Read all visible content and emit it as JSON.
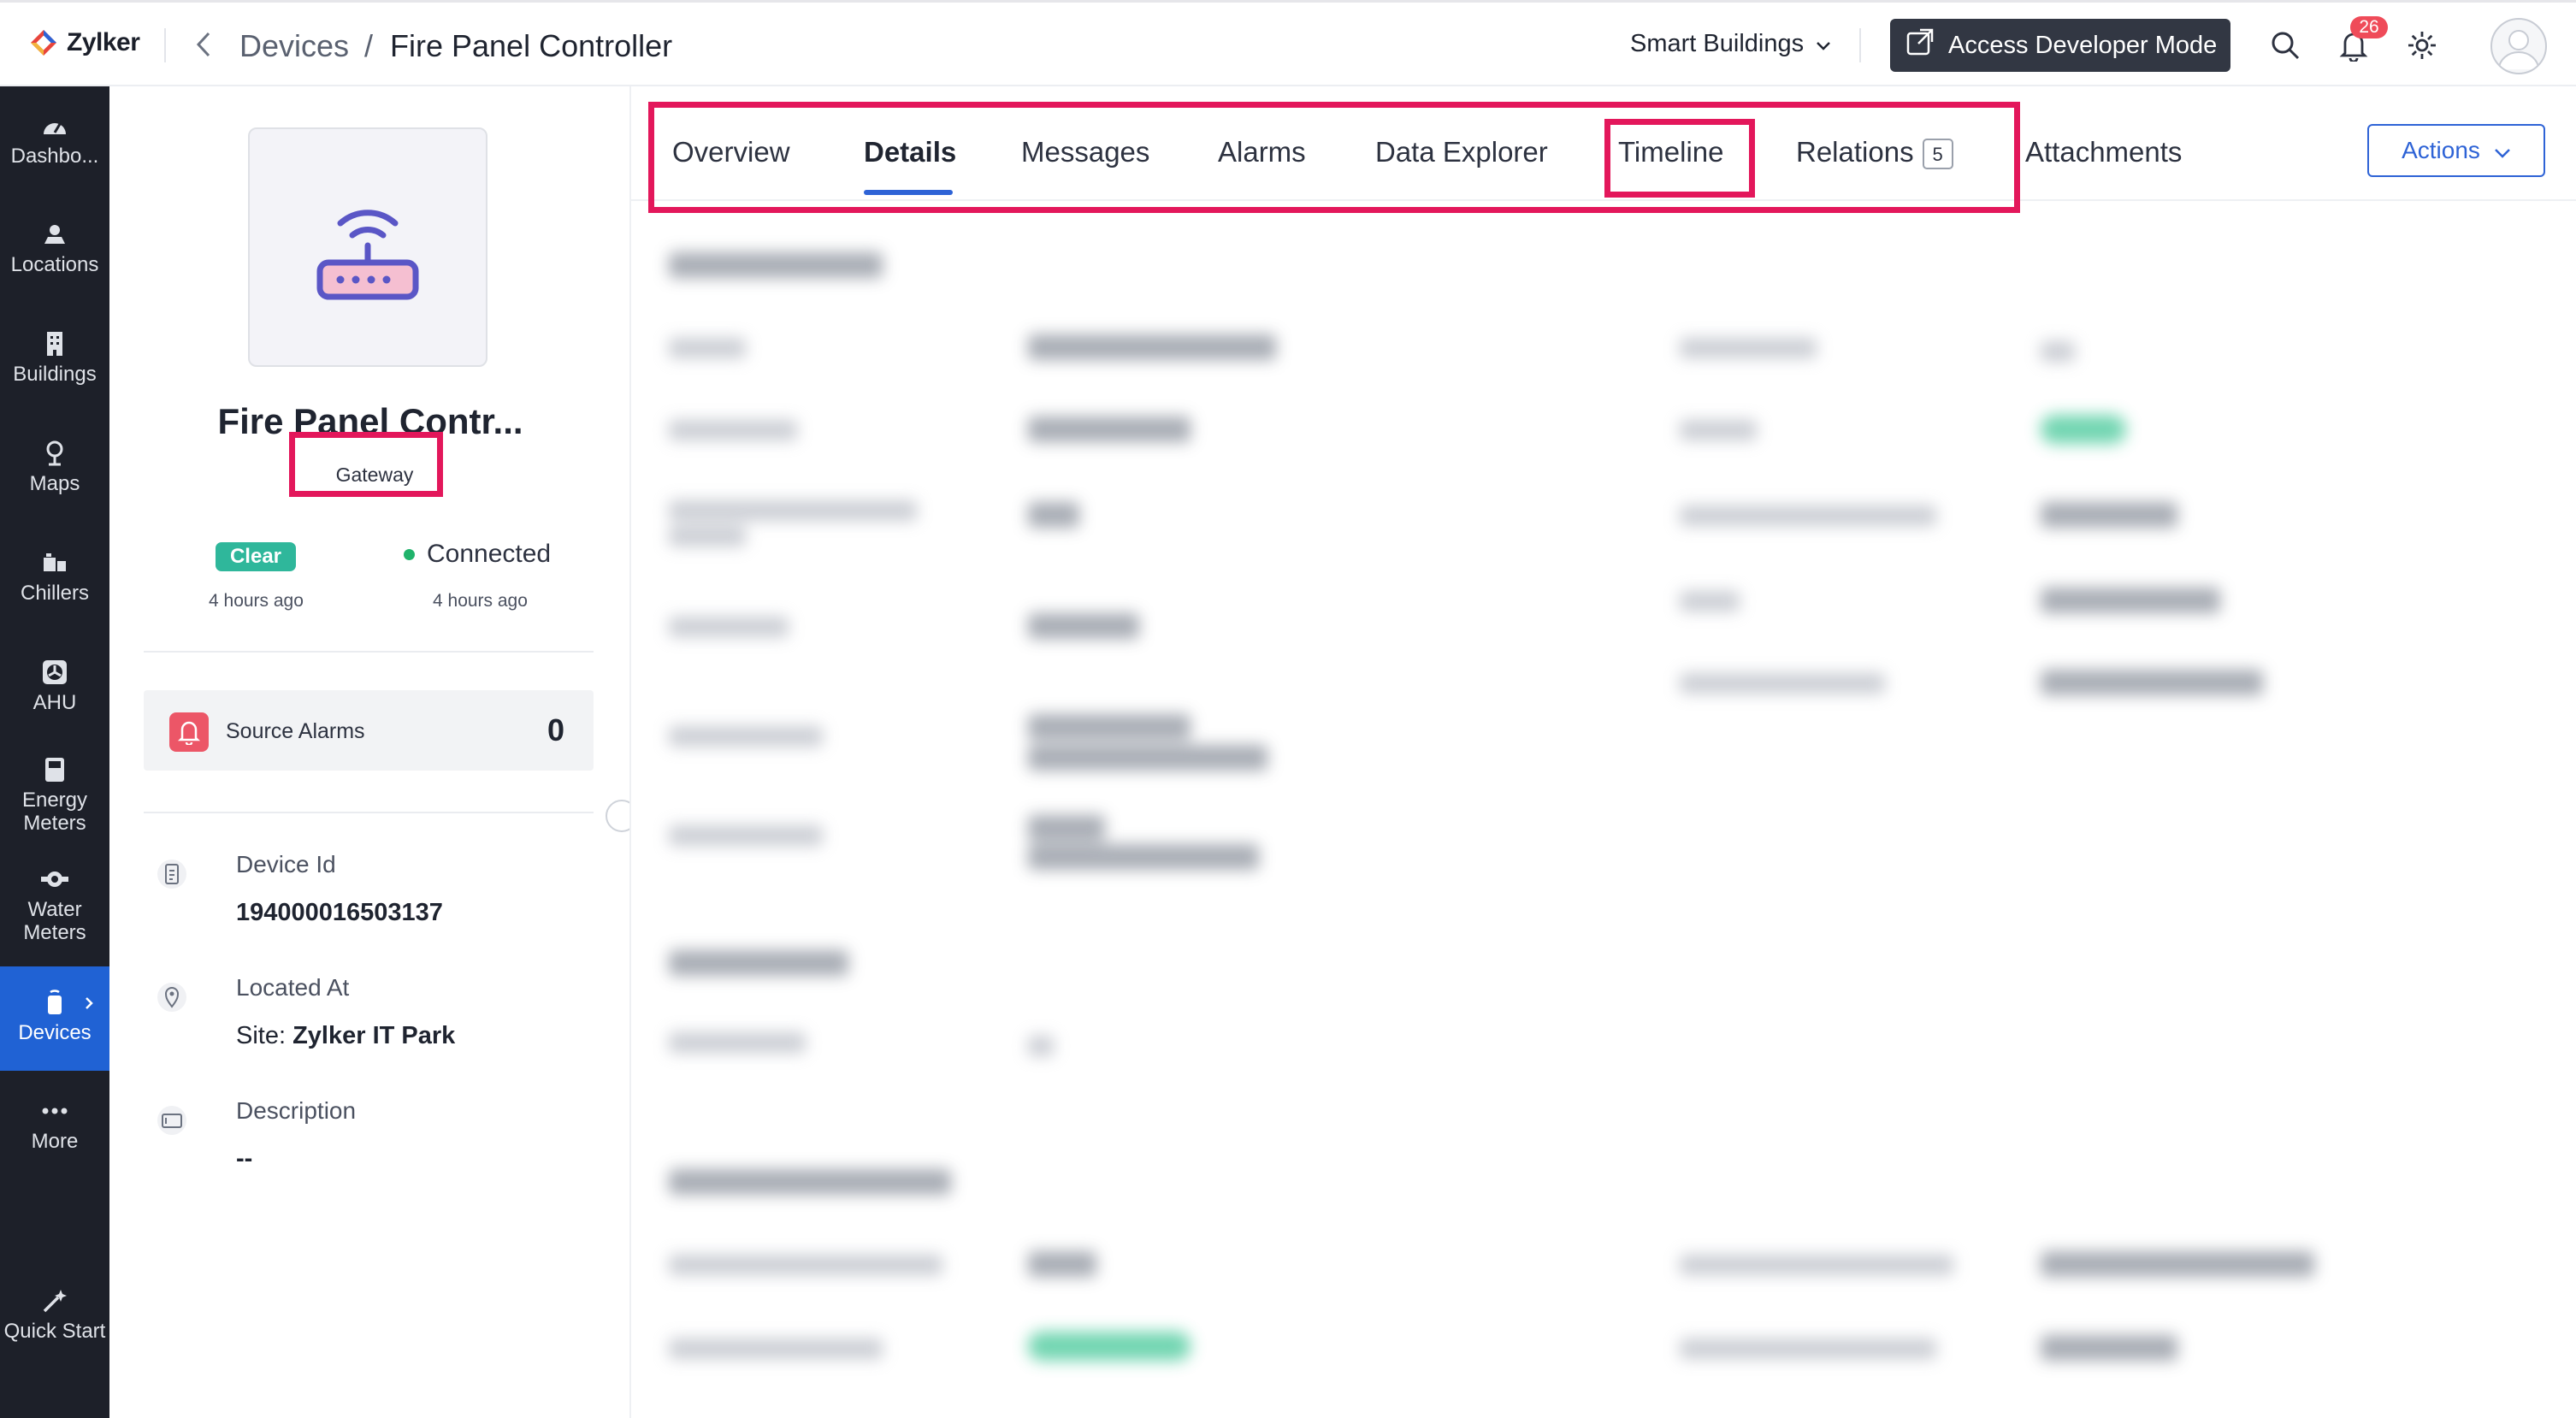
{
  "header": {
    "brand": "Zylker",
    "breadcrumb": {
      "parent": "Devices",
      "separator": "/",
      "current": "Fire Panel Controller"
    },
    "workspace": "Smart Buildings",
    "developer_mode_label": "Access Developer Mode",
    "notification_count": "26",
    "icons": [
      "back-chevron-icon",
      "chevron-down-icon",
      "external-link-icon",
      "search-icon",
      "bell-icon",
      "gear-icon",
      "avatar"
    ]
  },
  "sidebar": {
    "items": [
      {
        "label": "Dashbo...",
        "icon": "dashboard-gauge-icon"
      },
      {
        "label": "Locations",
        "icon": "location-pin-icon"
      },
      {
        "label": "Buildings",
        "icon": "building-icon"
      },
      {
        "label": "Maps",
        "icon": "map-pin-icon"
      },
      {
        "label": "Chillers",
        "icon": "chiller-icon"
      },
      {
        "label": "AHU",
        "icon": "fan-icon"
      },
      {
        "label": "Energy Meters",
        "icon": "energy-meter-icon"
      },
      {
        "label": "Water Meters",
        "icon": "water-meter-icon"
      },
      {
        "label": "Devices",
        "icon": "device-icon",
        "active": true
      },
      {
        "label": "More",
        "icon": "more-dots-icon"
      },
      {
        "label": "Quick Start",
        "icon": "magic-wand-icon"
      }
    ]
  },
  "device": {
    "name": "Fire Panel Contr...",
    "type": "Gateway",
    "alarm_status": "Clear",
    "alarm_status_time": "4 hours ago",
    "connection_status": "Connected",
    "connection_time": "4 hours ago",
    "source_alarms_label": "Source Alarms",
    "source_alarms_count": "0",
    "info": [
      {
        "label": "Device Id",
        "value": "194000016503137",
        "icon": "id-card-icon"
      },
      {
        "label": "Located At",
        "value_prefix": "Site: ",
        "value": "Zylker IT Park",
        "icon": "location-pin-icon"
      },
      {
        "label": "Description",
        "value": "--",
        "icon": "description-icon"
      }
    ]
  },
  "tabs": [
    {
      "label": "Overview"
    },
    {
      "label": "Details",
      "active": true
    },
    {
      "label": "Messages"
    },
    {
      "label": "Alarms"
    },
    {
      "label": "Data Explorer"
    },
    {
      "label": "Timeline"
    },
    {
      "label": "Relations",
      "count": "5"
    },
    {
      "label": "Attachments"
    }
  ],
  "actions_label": "Actions",
  "colors": {
    "sidebar_bg": "#1d2029",
    "active_nav": "#2062d4",
    "accent_blue": "#2e63d6",
    "highlight": "#e3175b",
    "clear_badge": "#2fb79b",
    "connected_dot": "#20b36b",
    "alarm_icon_bg": "#ec5667"
  }
}
